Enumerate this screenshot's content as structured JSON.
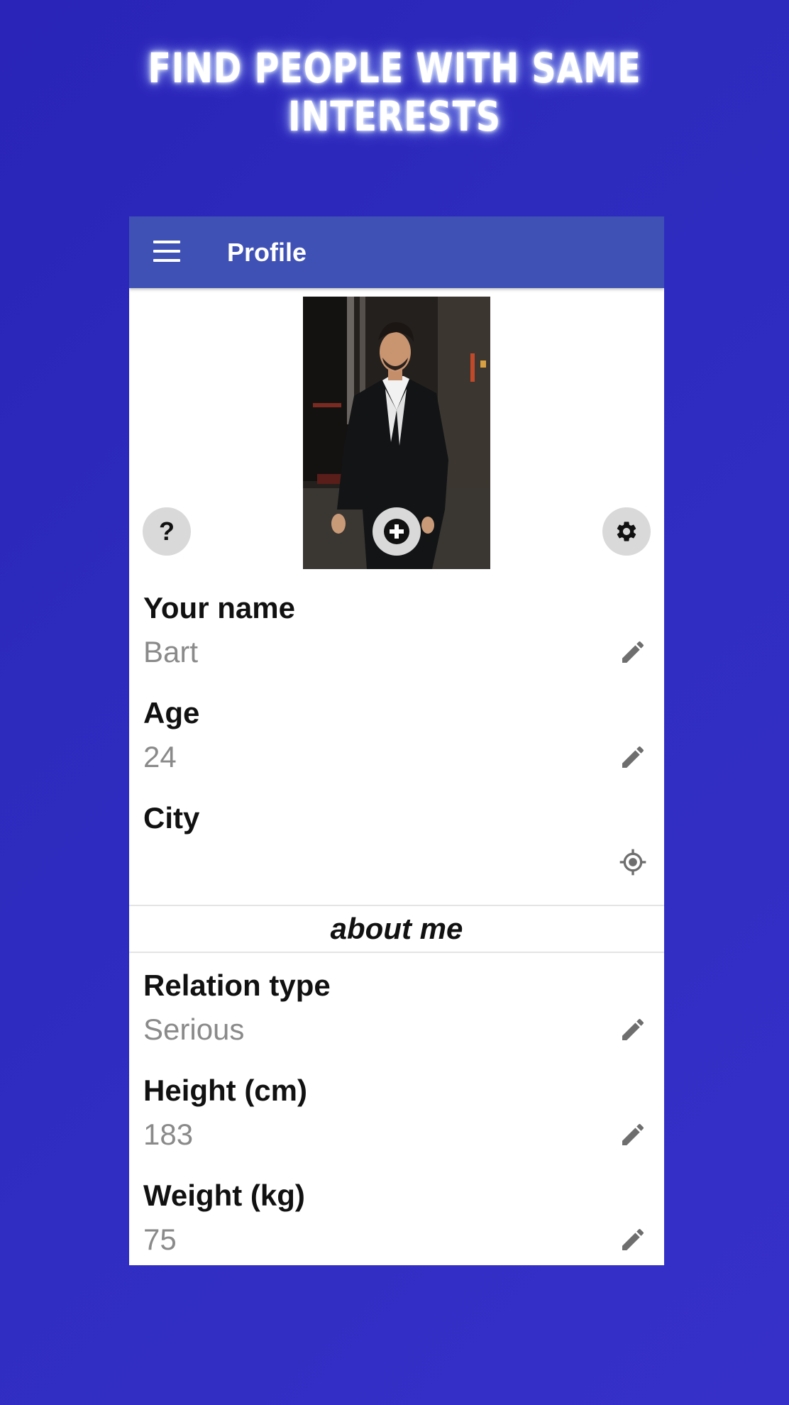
{
  "headline": "FIND PEOPLE WITH SAME INTERESTS",
  "appbar": {
    "title": "Profile",
    "menu_icon": "hamburger-menu-icon",
    "color": "#3f51b5"
  },
  "photo": {
    "add_icon": "add-circle-icon"
  },
  "actions": {
    "help_label": "?",
    "help_icon": "question-icon",
    "settings_icon": "gear-icon"
  },
  "fields": {
    "name": {
      "label": "Your name",
      "value": "Bart",
      "icon": "pencil-icon"
    },
    "age": {
      "label": "Age",
      "value": "24",
      "icon": "pencil-icon"
    },
    "city": {
      "label": "City",
      "value": "",
      "icon": "crosshair-location-icon"
    }
  },
  "about": {
    "title": "about me",
    "relation": {
      "label": "Relation type",
      "value": "Serious",
      "icon": "pencil-icon"
    },
    "height": {
      "label": "Height (cm)",
      "value": "183",
      "icon": "pencil-icon"
    },
    "weight": {
      "label": "Weight (kg)",
      "value": "75",
      "icon": "pencil-icon"
    }
  },
  "colors": {
    "background": "#2e2cc0",
    "label": "#111111",
    "value": "#8a8a8a",
    "icon": "#6e6e6e"
  }
}
